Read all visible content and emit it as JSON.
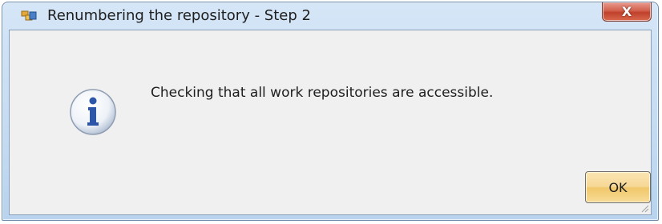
{
  "window": {
    "title": "Renumbering the repository - Step 2",
    "title_icon": "repository-icon",
    "close_glyph": "X"
  },
  "dialog": {
    "icon": "info-icon",
    "message": "Checking that all work repositories are accessible.",
    "ok_label": "OK"
  }
}
